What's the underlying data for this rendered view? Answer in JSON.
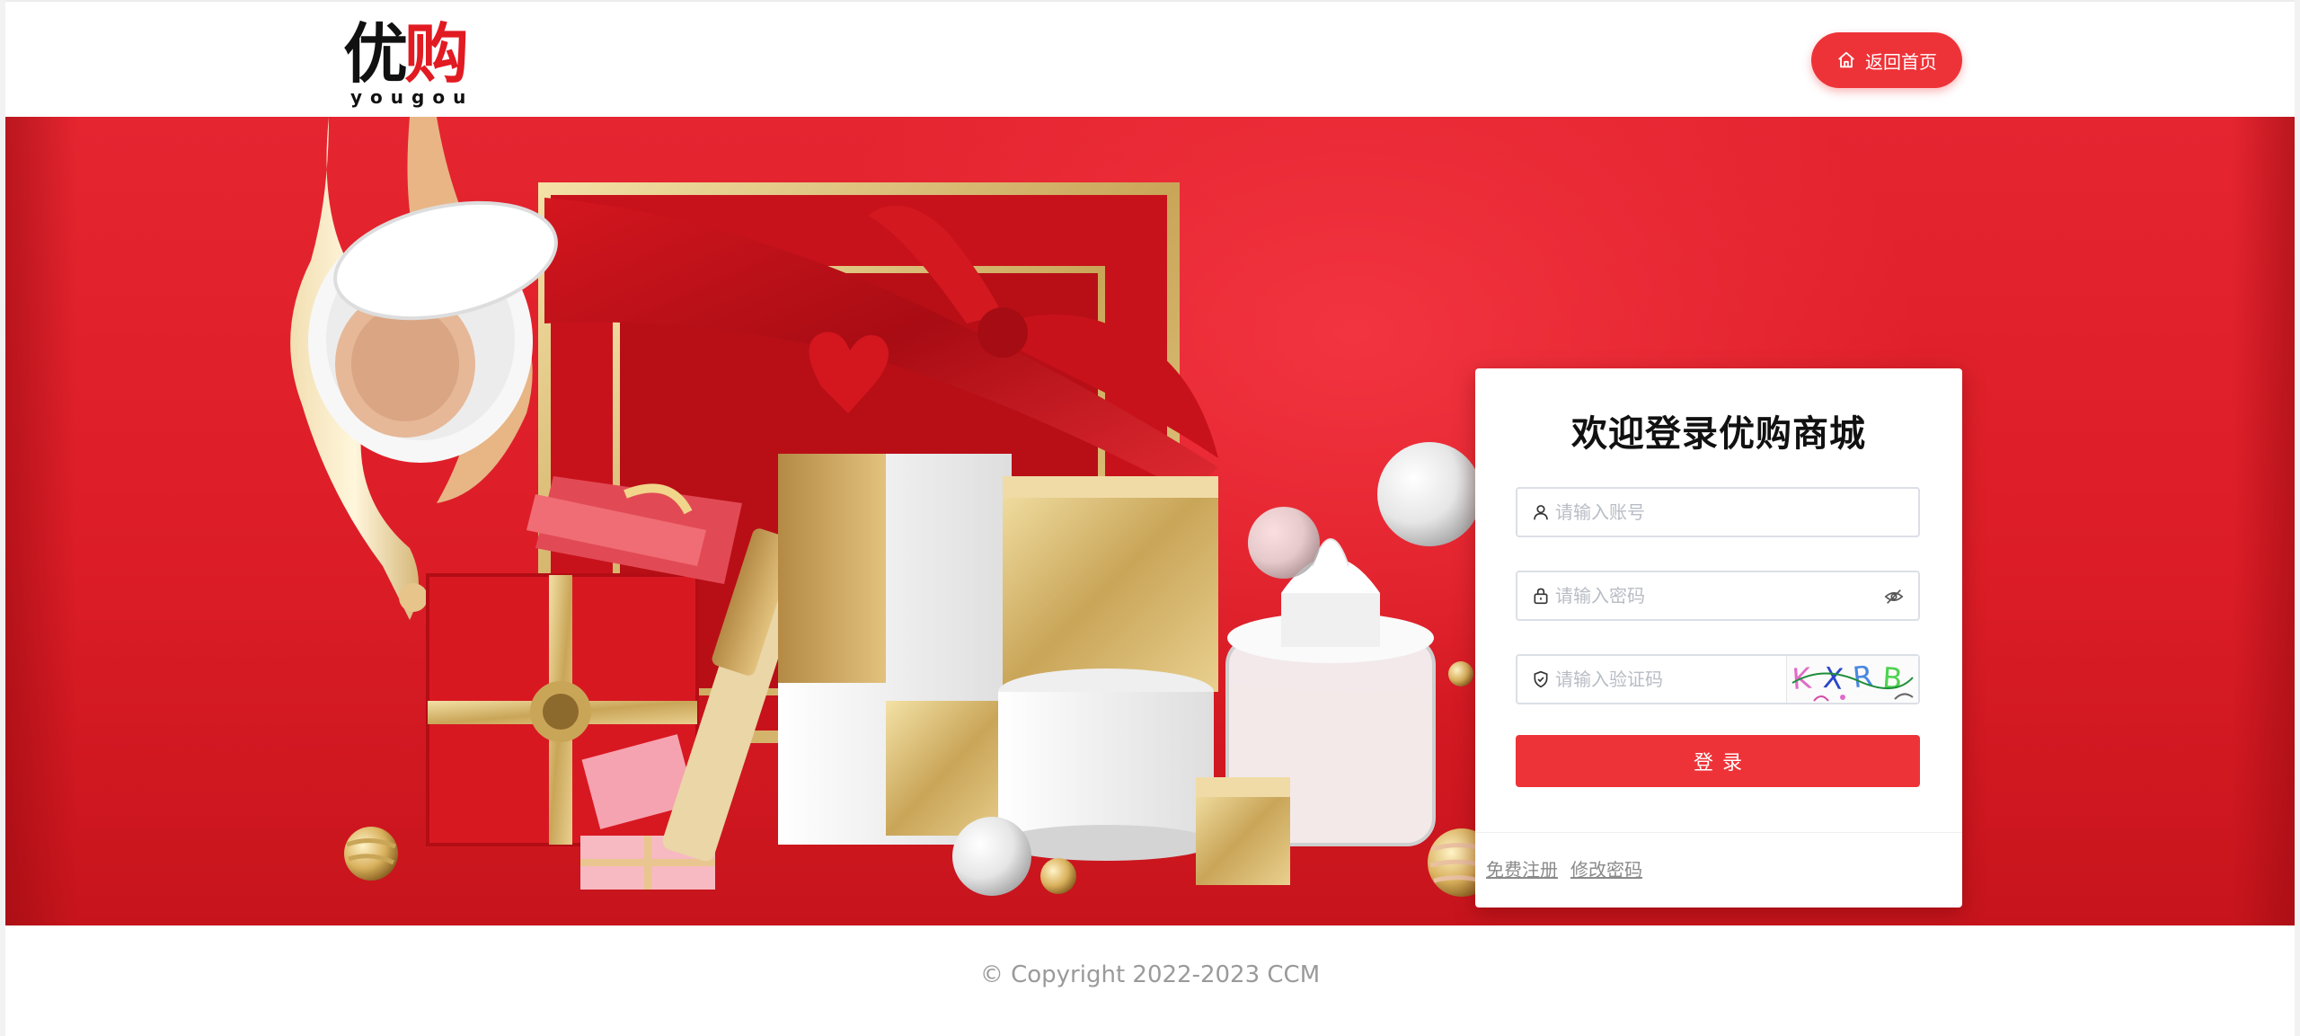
{
  "header": {
    "logo_cn_black": "优",
    "logo_cn_red": "购",
    "logo_en": "yougou",
    "home_button_label": "返回首页"
  },
  "login": {
    "title": "欢迎登录优购商城",
    "username_placeholder": "请输入账号",
    "password_placeholder": "请输入密码",
    "captcha_placeholder": "请输入验证码",
    "captcha_text": "KXRB",
    "submit_label": "登录",
    "register_link": "免费注册",
    "change_password_link": "修改密码"
  },
  "footer": {
    "copyright": "© Copyright 2022-2023 CCM"
  },
  "colors": {
    "brand_red": "#ee3338",
    "banner_red": "#dc1d27"
  },
  "icons": {
    "home": "home-icon",
    "user": "user-icon",
    "lock": "lock-icon",
    "shield": "shield-icon",
    "eye": "eye-closed-icon"
  }
}
